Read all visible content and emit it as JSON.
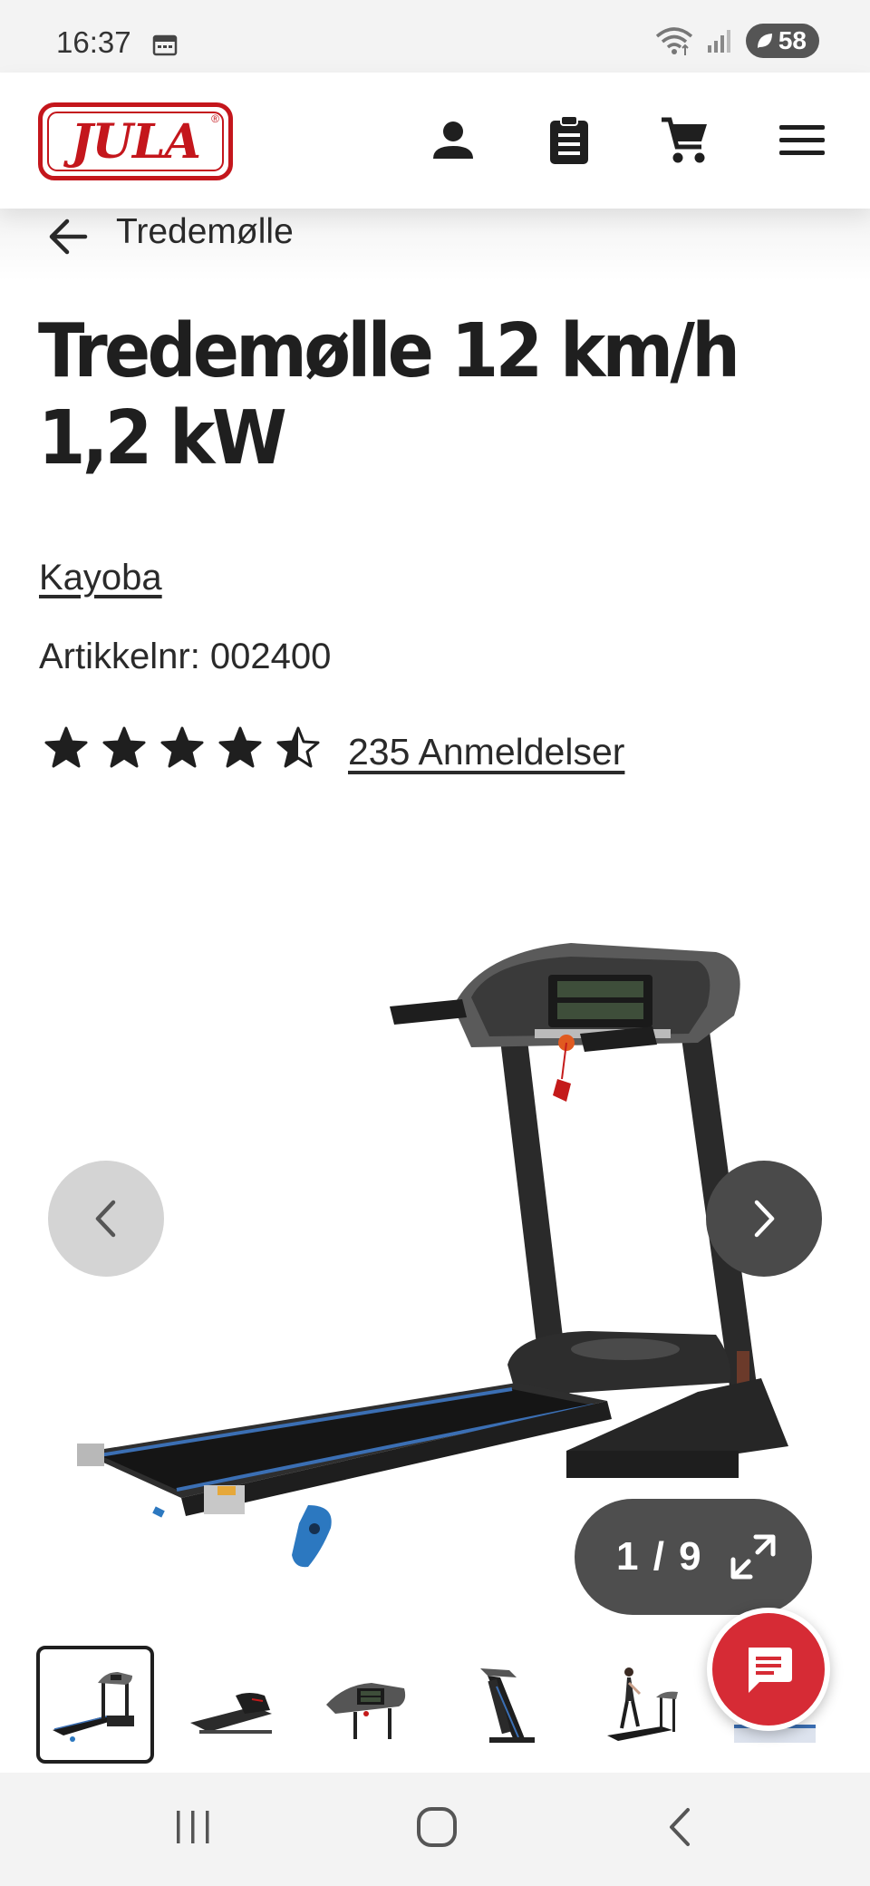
{
  "status_bar": {
    "time": "16:37",
    "battery": "58"
  },
  "header": {
    "logo_text": "JULA",
    "logo_reg": "®",
    "icons": [
      "account-icon",
      "shopping-list-icon",
      "cart-icon",
      "menu-icon"
    ]
  },
  "breadcrumb": {
    "label": "Tredemølle"
  },
  "product": {
    "title": "Tredemølle 12 km/h 1,2 kW",
    "brand": "Kayoba",
    "article_number": "Artikkelnr: 002400",
    "rating": 4.5,
    "rating_max": 5,
    "reviews_label": "235 Anmeldelser"
  },
  "gallery": {
    "counter": "1 / 9",
    "current": 1,
    "total": 9
  },
  "colors": {
    "brand_red": "#c4161c",
    "chat_red": "#d62b35",
    "dark_text": "#1f1f1f"
  }
}
